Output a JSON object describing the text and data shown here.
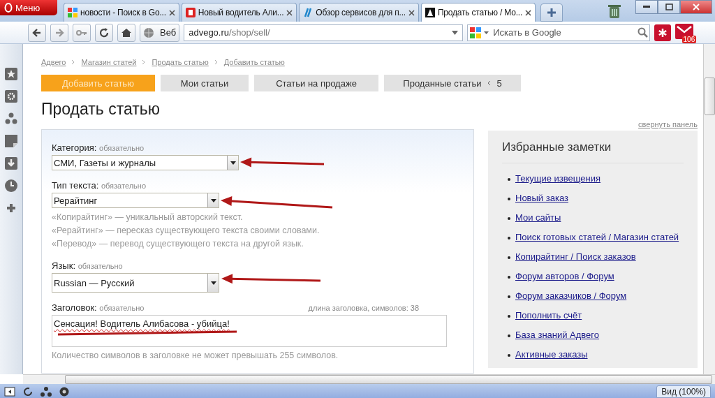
{
  "browser": {
    "menu_button": "Меню",
    "tabs": [
      {
        "title": "новости - Поиск в Go...",
        "selected": false
      },
      {
        "title": "Новый водитель Али...",
        "selected": false
      },
      {
        "title": "Обзор сервисов для п...",
        "selected": false
      },
      {
        "title": "Продать статью / Мо...",
        "selected": true
      }
    ],
    "view_label": "Веб",
    "address": {
      "host": "advego.ru",
      "path": "/shop/sell/"
    },
    "search": {
      "placeholder": "Искать в Google"
    },
    "mail_badge": "106"
  },
  "page": {
    "breadcrumbs": [
      "Адвего",
      "Магазин статей",
      "Продать статью",
      "Добавить статью"
    ],
    "nav_tabs": [
      {
        "label": "Добавить статью",
        "selected": true
      },
      {
        "label": "Мои статьи",
        "selected": false
      },
      {
        "label": "Статьи на продаже",
        "selected": false
      },
      {
        "label": "Проданные статьи",
        "count": "5",
        "selected": false
      }
    ],
    "title": "Продать статью",
    "collapse_link": "свернуть панель",
    "form": {
      "fields": [
        {
          "kind": "select",
          "label": "Категория:",
          "required": "обязательно",
          "value": "СМИ, Газеты и журналы"
        },
        {
          "kind": "select",
          "label": "Тип текста:",
          "required": "обязательно",
          "value": "Рерайтинг",
          "hints": [
            "«Копирайтинг» — уникальный авторский текст.",
            "«Рерайтинг» — пересказ существующего текста своими словами.",
            "«Перевод» — перевод существующего текста на другой язык."
          ]
        },
        {
          "kind": "select",
          "label": "Язык:",
          "required": "обязательно",
          "value": "Russian — Русский"
        },
        {
          "kind": "textarea",
          "label": "Заголовок:",
          "required": "обязательно",
          "counter": "длина заголовка, символов: 38",
          "value": "Сенсация! Водитель Алибасова - убийца!",
          "note": "Количество символов в заголовке не может превышать 255 символов."
        }
      ]
    },
    "sidebar": {
      "title": "Избранные заметки",
      "links": [
        "Текущие извещения",
        "Новый заказ",
        "Мои сайты",
        "Поиск готовых статей / Магазин статей",
        "Копирайтинг / Поиск заказов",
        "Форум авторов / Форум",
        "Форум заказчиков / Форум",
        "Пополнить счёт",
        "База знаний Адвего",
        "Активные заказы"
      ]
    }
  },
  "status_bar": {
    "zoom": "Вид (100%)"
  }
}
